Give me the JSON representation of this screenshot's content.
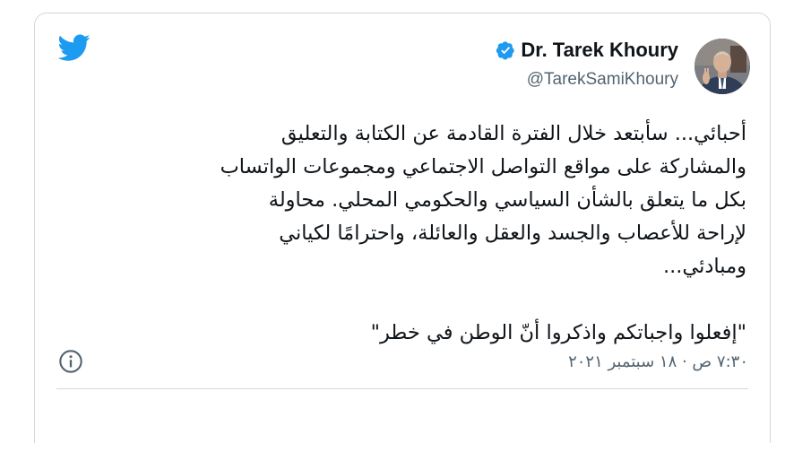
{
  "author": {
    "name": "Dr. Tarek Khoury",
    "handle": "@TarekSamiKhoury",
    "verified": true
  },
  "tweet": {
    "lines": [
      "أحبائي... سأبتعد خلال الفترة القادمة عن الكتابة والتعليق",
      "والمشاركة على مواقع التواصل الاجتماعي ومجموعات الواتساب",
      "بكل ما يتعلق بالشأن السياسي والحكومي المحلي. محاولة",
      "لإراحة للأعصاب والجسد والعقل والعائلة، واحترامًا لكياني",
      "ومبادئي...",
      "\"إفعلوا واجباتكم واذكروا أنّ الوطن في خطر\""
    ]
  },
  "timestamp": "٧:٣٠ ص · ١٨ سبتمبر ٢٠٢١",
  "colors": {
    "twitter_blue": "#1d9bf0",
    "text": "#0f1419",
    "muted": "#536471",
    "border": "#cfd9de"
  },
  "icons": {
    "logo": "twitter-bird-icon",
    "verified": "verified-badge-icon",
    "info": "info-icon"
  }
}
